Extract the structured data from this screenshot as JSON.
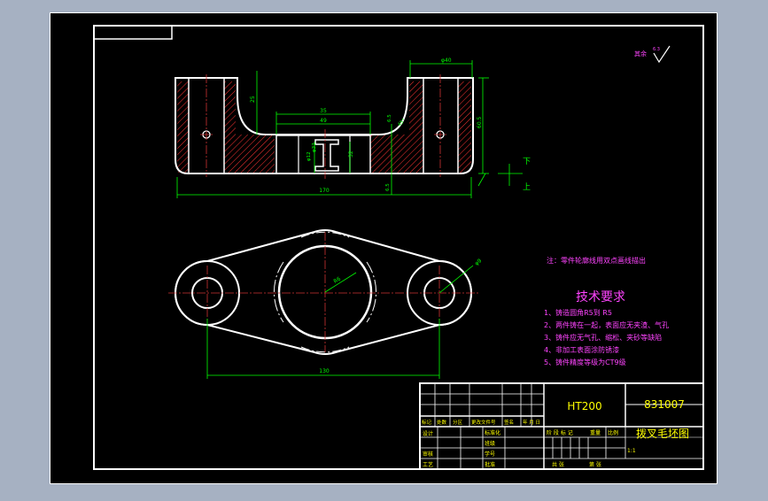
{
  "colors": {
    "desktop": "#a6b1c2",
    "paper": "#000000",
    "frame": "#ffffff",
    "outline": "#ffffff",
    "dimension": "#00ff00",
    "hatch": "#ff3333",
    "center": "#cc3333",
    "note": "#ff44ff",
    "table_text": "#ffff00"
  },
  "front_view": {
    "dims": {
      "top_width": "φ40",
      "left_step": "25",
      "inner_width_35": "35",
      "inner_width_49": "49",
      "height_total": "60.5",
      "bore_small": "φ12",
      "bore_big": "φ37",
      "center_height": "32",
      "bottom_gap_left": "6.5",
      "bottom_gap_right": "6.5",
      "overall_width": "170",
      "chamfer": "45°"
    },
    "labels": {
      "down": "下",
      "up": "上"
    }
  },
  "top_view": {
    "dims": {
      "radius_small": "R6",
      "radius_big": "φ9",
      "length": "130"
    }
  },
  "roughness": {
    "label": "其余",
    "value": "6.3"
  },
  "notes": {
    "outline_note": "注：零件轮廓线用双点画线描出",
    "title": "技术要求",
    "items": [
      "1、铸造圆角R5到 R5",
      "2、两件铸在一起，表面应无夹渣、气孔",
      "3、铸件应无气孔、缩松、夹砂等缺陷",
      "4、非加工表面涂防锈漆",
      "5、铸件精度等级为CT9级"
    ]
  },
  "title_block": {
    "material": "HT200",
    "drawing_no": "831007",
    "part_name": "拨叉毛坯图",
    "scale": "1:1",
    "header_row": [
      "标记",
      "处数",
      "分区",
      "更改文件号",
      "签名",
      "年 月 日"
    ],
    "left_rows": [
      "设计",
      "",
      "",
      "审核",
      "工艺"
    ],
    "mid_labels": [
      "标准化",
      "班级",
      "学号",
      "批准"
    ],
    "stage_labels": [
      "阶 段 标 记",
      "重量",
      "比例"
    ],
    "sheet_labels": [
      "共 张",
      "第 张"
    ]
  }
}
